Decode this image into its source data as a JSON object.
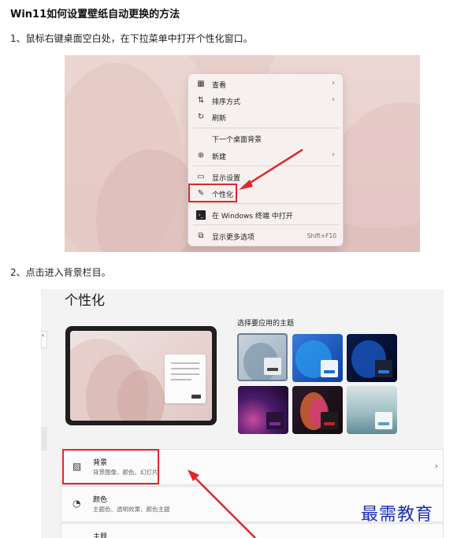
{
  "title": "Win11如何设置壁纸自动更换的方法",
  "steps": [
    "1、鼠标右键桌面空白处，在下拉菜单中打开个性化窗口。",
    "2、点击进入背景栏目。"
  ],
  "context_menu": {
    "items": [
      {
        "icon": "view-icon",
        "label": "查看",
        "has_arrow": true
      },
      {
        "icon": "sort-icon",
        "label": "排序方式",
        "has_arrow": true
      },
      {
        "icon": "refresh-icon",
        "label": "刷新",
        "has_arrow": false
      },
      {
        "icon": "",
        "label": "下一个桌面背景",
        "has_arrow": false
      },
      {
        "icon": "new-icon",
        "label": "新建",
        "has_arrow": true
      },
      {
        "icon": "display-settings-icon",
        "label": "显示设置",
        "has_arrow": false
      },
      {
        "icon": "personalize-icon",
        "label": "个性化",
        "has_arrow": false
      },
      {
        "icon": "terminal-icon",
        "label": "在 Windows 终端 中打开",
        "has_arrow": false
      },
      {
        "icon": "more-options-icon",
        "label": "显示更多选项",
        "shortcut": "Shift+F10"
      }
    ],
    "chevron": "›"
  },
  "settings": {
    "page_title": "个性化",
    "left_tab": "‹",
    "themes_label": "选择要应用的主题",
    "chevron": "›",
    "rows": [
      {
        "icon": "image-icon",
        "title": "背景",
        "subtitle": "背景图像、颜色、幻灯片"
      },
      {
        "icon": "palette-icon",
        "title": "颜色",
        "subtitle": "主题色、透明效果、颜色主题"
      },
      {
        "icon": "brush-icon",
        "title": "主题",
        "subtitle": ""
      }
    ]
  },
  "watermark": "最需教育"
}
